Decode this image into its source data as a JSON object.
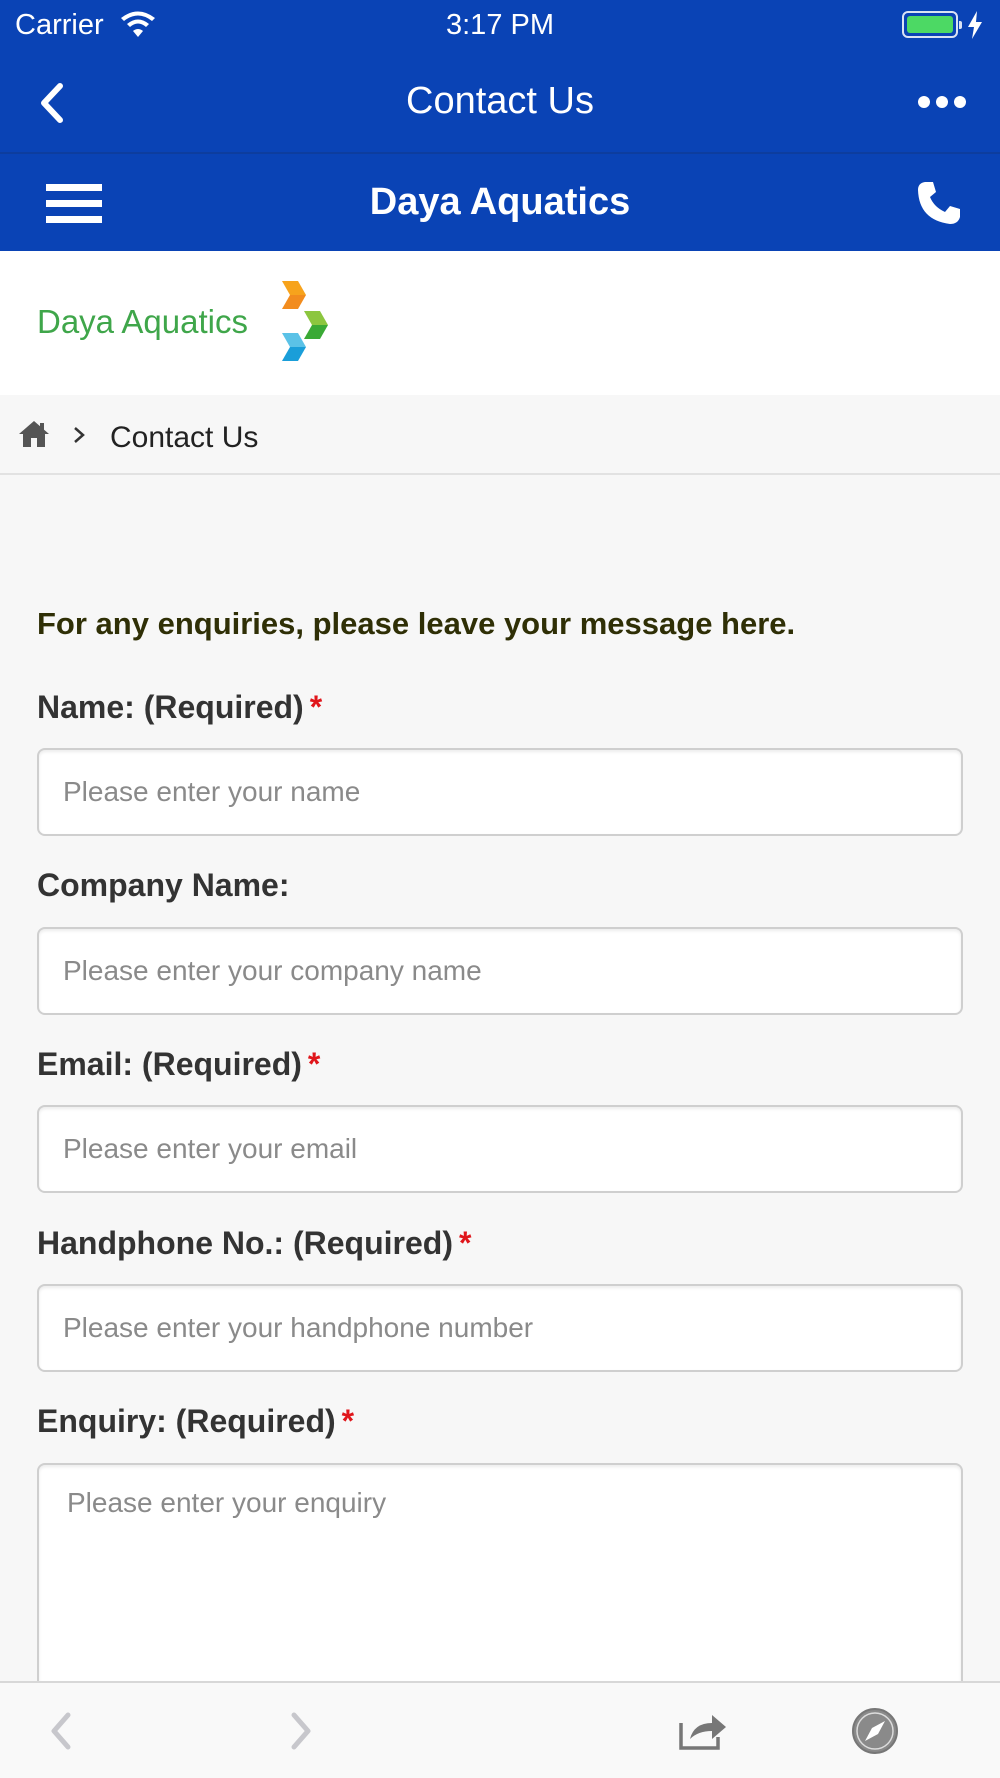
{
  "status_bar": {
    "carrier": "Carrier",
    "time": "3:17 PM",
    "battery_color": "#4cd964"
  },
  "nav_bar": {
    "title": "Contact Us",
    "back_icon": "chevron-left-icon",
    "more_icon": "ellipsis-icon",
    "background": "#0a43b5"
  },
  "app_header": {
    "brand": "Daya Aquatics",
    "menu_icon": "hamburger-icon",
    "phone_icon": "phone-icon"
  },
  "logo": {
    "text": "Daya Aquatics",
    "text_color": "#3fa64a"
  },
  "breadcrumb": {
    "home_icon": "home-icon",
    "current": "Contact Us"
  },
  "form": {
    "intro": "For any enquiries, please leave your message here.",
    "required_mark": "*",
    "fields": [
      {
        "label": "Name: (Required)",
        "required": true,
        "placeholder": "Please enter your name",
        "value": ""
      },
      {
        "label": "Company Name:",
        "required": false,
        "placeholder": "Please enter your company name",
        "value": ""
      },
      {
        "label": "Email: (Required)",
        "required": true,
        "placeholder": "Please enter your email",
        "value": ""
      },
      {
        "label": "Handphone No.: (Required)",
        "required": true,
        "placeholder": "Please enter your handphone number",
        "value": ""
      },
      {
        "label": "Enquiry: (Required)",
        "required": true,
        "placeholder": "Please enter your enquiry",
        "value": ""
      }
    ]
  },
  "toolbar": {
    "back_icon": "chevron-left-icon",
    "forward_icon": "chevron-right-icon",
    "share_icon": "share-icon",
    "browser_icon": "compass-icon"
  }
}
